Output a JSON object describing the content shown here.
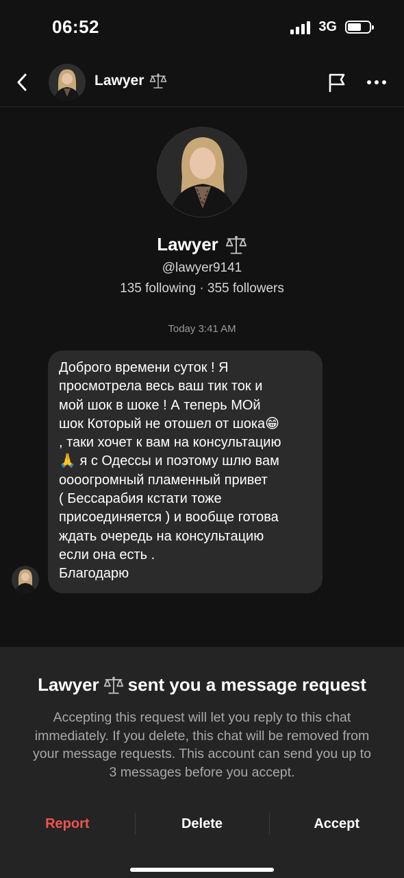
{
  "status_bar": {
    "time": "06:52",
    "network": "3G",
    "battery_level": 0.55
  },
  "header": {
    "name": "Lawyer",
    "badge_icon": "scales-icon"
  },
  "profile": {
    "name": "Lawyer",
    "badge_icon": "scales-icon",
    "handle": "@lawyer9141",
    "stats": "135 following · 355 followers"
  },
  "conversation": {
    "timestamp": "Today 3:41 AM",
    "message": {
      "text": "Доброго времени суток ! Я\nпросмотрела весь ваш тик ток и\nмой шок в шоке ! А теперь МОй\nшок Который не отошел от шока😁\n, таки хочет к вам на консультацию\n🙏 я с Одессы и поэтому шлю вам\nоооогромный пламенный привет\n( Бессарабия кстати тоже\nприсоединяется ) и вообще готова\nждать очередь на консультацию\nесли она есть .\nБлагодарю"
    }
  },
  "request_sheet": {
    "title_name": "Lawyer",
    "title_suffix": "sent you a message request",
    "description": "Accepting this request will let you reply to this chat immediately. If you delete, this chat will be removed from your message requests. This account can send you up to 3 messages before you accept.",
    "actions": {
      "report": "Report",
      "delete": "Delete",
      "accept": "Accept"
    }
  },
  "colors": {
    "background": "#121212",
    "bubble": "#2b2b2b",
    "sheet": "#242424",
    "report": "#ef5350"
  }
}
